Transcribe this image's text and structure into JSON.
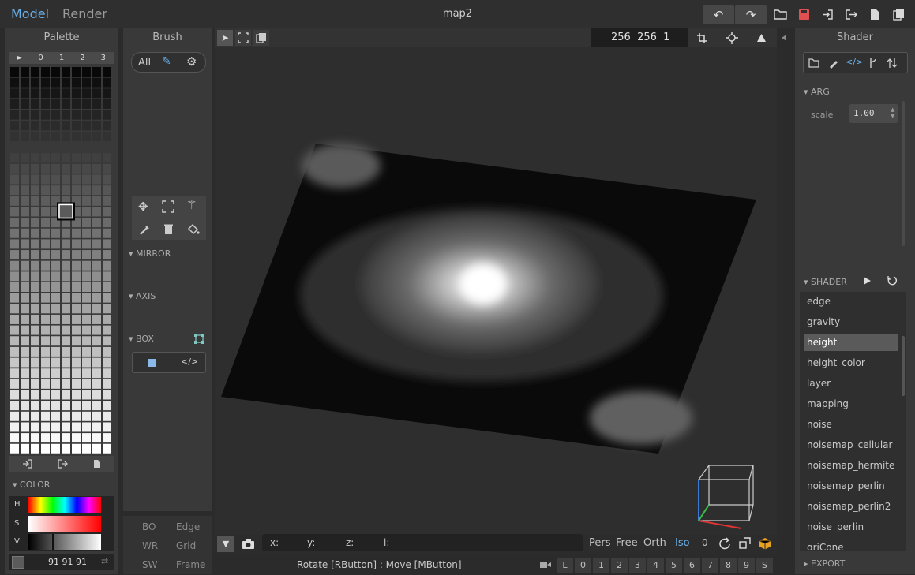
{
  "topbar": {
    "tab_model": "Model",
    "tab_render": "Render",
    "title": "map2"
  },
  "palette": {
    "title": "Palette",
    "header": [
      "►",
      "0",
      "1",
      "2",
      "3"
    ],
    "rows": 36,
    "cols": 10,
    "selected": {
      "row": 13,
      "col": 5
    }
  },
  "color": {
    "section": "COLOR",
    "h": "H",
    "s": "S",
    "v": "V",
    "value": "91 91 91",
    "swatch": "#5b5b5b"
  },
  "brush": {
    "title": "Brush",
    "filter_all": "All",
    "shapes": [
      "L",
      "C",
      "P",
      "V",
      "F",
      "B"
    ],
    "active_shape": "B",
    "actions": [
      "Attach",
      "Erase",
      "Paint"
    ],
    "mirror": "MIRROR",
    "axis": "AXIS",
    "box": "BOX",
    "xyz": [
      "X",
      "Y",
      "Z"
    ]
  },
  "bottom_left": {
    "items": [
      "BO",
      "Edge",
      "WR",
      "Grid",
      "SW",
      "Frame"
    ]
  },
  "viewport": {
    "size": "256  256  1",
    "coords": {
      "x": "x:-",
      "y": "y:-",
      "z": "z:-",
      "i": "i:-"
    },
    "status": "Rotate [RButton] : Move [MButton]",
    "views": [
      "Pers",
      "Free",
      "Orth",
      "Iso"
    ],
    "active_view": "Iso",
    "zero": "0",
    "layers": [
      "L",
      "0",
      "1",
      "2",
      "3",
      "4",
      "5",
      "6",
      "7",
      "8",
      "9",
      "S"
    ]
  },
  "shader": {
    "title": "Shader",
    "arg": "ARG",
    "scale_label": "scale",
    "scale_value": "1.00",
    "section": "SHADER",
    "items": [
      "edge",
      "gravity",
      "height",
      "height_color",
      "layer",
      "mapping",
      "noise",
      "noisemap_cellular",
      "noisemap_hermite",
      "noisemap_perlin",
      "noisemap_perlin2",
      "noise_perlin",
      "griCone"
    ],
    "selected": "height",
    "export": "EXPORT"
  },
  "colors": {
    "accent": "#6ab0e8",
    "save": "#e05050",
    "selection": "#5a5a5a"
  }
}
